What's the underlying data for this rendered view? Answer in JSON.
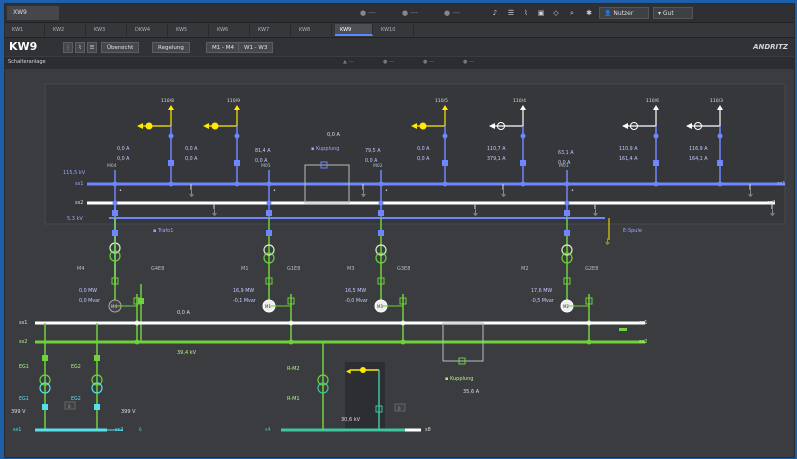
{
  "app_tab": "XW9",
  "toolbar": {
    "indicators": [
      "---",
      "---",
      "---",
      "---",
      "---"
    ],
    "user": "Nutzer",
    "lang": "Gut"
  },
  "station_tabs": [
    "KW1",
    "KW2",
    "KW3",
    "DKW4",
    "KW5",
    "KW6",
    "KW7",
    "KW8",
    "KW9",
    "KW10"
  ],
  "active_tab": "KW9",
  "header": {
    "title": "KW9",
    "btn_overview": "Übersicht",
    "btn_regelung": "Regelung",
    "btn_m": "M1 - M4",
    "btn_w": "W1 - W3",
    "logo": "ANDRITZ"
  },
  "sub": {
    "title": "Schalteranlage",
    "ind": [
      "---",
      "---",
      "---",
      "---"
    ]
  },
  "diagram": {
    "feeders_top": [
      "110/8",
      "110/9",
      "110/5",
      "110/4",
      "110/6",
      "110/3"
    ],
    "busbar_labels": {
      "hv1": "ss1",
      "hv2": "ss2",
      "mv1": "ss1",
      "mv2": "ss2",
      "lv1": "ss1",
      "lv2": "ss2",
      "lv3": "s4",
      "lv4": "s8"
    },
    "hv_left": {
      "v1": "115,5 kV",
      "v2": "5,3 kV"
    },
    "gen_labels": [
      "M4",
      "M1",
      "M3",
      "M2"
    ],
    "gen_codes": [
      "G4E8",
      "G1E8",
      "G3E8",
      "G2E8"
    ],
    "gen_values": [
      {
        "p": "0,0 MW",
        "q": "0,0 Mvar"
      },
      {
        "p": "16,9 MW",
        "q": "-0,1 Mvar"
      },
      {
        "p": "16,5 MW",
        "q": "-0,0 Mvar"
      },
      {
        "p": "17,6 MW",
        "q": "-0,5 Mvar"
      }
    ],
    "gen_symbols": [
      "M4",
      "M1",
      "M3",
      "M2"
    ],
    "hv_meas": [
      {
        "a": "0,0 A",
        "b": "0,0 A"
      },
      {
        "a": "0,0 A",
        "b": "0,0 A"
      },
      {
        "a": "81,4 A",
        "b": "0,0 A"
      },
      {
        "a": "79,5 A",
        "b": "0,0 A"
      },
      {
        "a": "0,0 A",
        "b": "0,0 A"
      },
      {
        "a": "110,7 A",
        "b": "379,1 A"
      },
      {
        "a": "63,1 A",
        "b": "0,0 A"
      },
      {
        "a": "110,9 A",
        "b": "161,4 A"
      },
      {
        "a": "116,9 A",
        "b": "164,1 A"
      }
    ],
    "bay_codes": [
      "M04",
      "M05",
      "M02",
      "M03"
    ],
    "kupplung": "Kupplung",
    "kupplung_val": "0,0 A",
    "tr_names": [
      "Trafo1",
      "E-Spule"
    ],
    "mv_val1": "0,0 A",
    "mv_val2": "39,4 kV",
    "mv_kupplung": "Kupplung",
    "mv_kupplung_val": "35,6 A",
    "lv_names": [
      "EG1",
      "EG2",
      "EG1",
      "EG2"
    ],
    "lv_vals": [
      "399 V",
      "399 V"
    ],
    "lv_small": [
      "0",
      "0"
    ],
    "mid_labels": [
      "R-M2",
      "R-M1"
    ],
    "mid_val": "30,6 kV",
    "mid_small": "0"
  },
  "colors": {
    "hv": "#6f86ff",
    "mv_green": "#6fd23a",
    "lv_cyan": "#58e0ea",
    "lv_teal": "#3ec69c",
    "white": "#ffffff",
    "yellow": "#ffea00"
  }
}
